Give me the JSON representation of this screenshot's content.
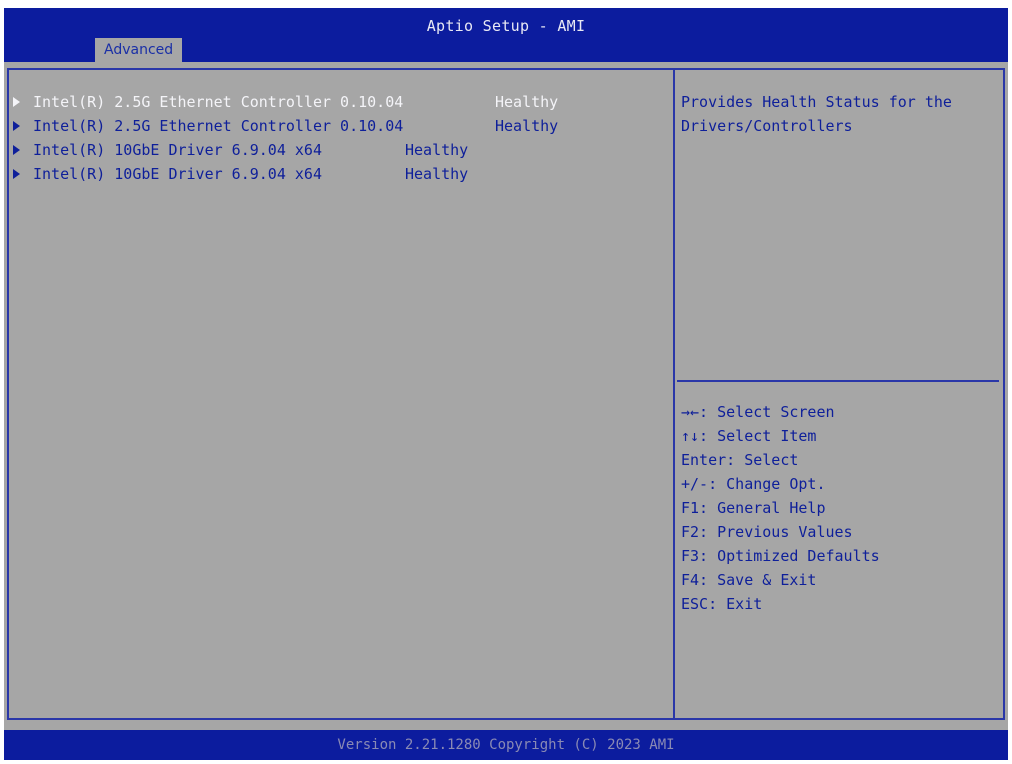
{
  "window": {
    "title": "Aptio Setup - AMI"
  },
  "tabs": [
    {
      "label": "Advanced",
      "active": true
    }
  ],
  "items": [
    {
      "label": "Intel(R) 2.5G Ethernet Controller 0.10.04",
      "status": "Healthy",
      "selected": true
    },
    {
      "label": "Intel(R) 2.5G Ethernet Controller 0.10.04",
      "status": "Healthy",
      "selected": false
    },
    {
      "label": "Intel(R) 10GbE Driver 6.9.04 x64",
      "status": "Healthy",
      "selected": false
    },
    {
      "label": "Intel(R) 10GbE Driver 6.9.04 x64",
      "status": "Healthy",
      "selected": false
    }
  ],
  "help": {
    "line1": "Provides Health Status for the",
    "line2": "Drivers/Controllers"
  },
  "keys": [
    "→←: Select Screen",
    "↑↓: Select Item",
    "Enter: Select",
    "+/-: Change Opt.",
    "F1: General Help",
    "F2: Previous Values",
    "F3: Optimized Defaults",
    "F4: Save & Exit",
    "ESC: Exit"
  ],
  "footer": {
    "text": "Version 2.21.1280 Copyright (C) 2023 AMI"
  },
  "colors": {
    "header_bg": "#0c1c9e",
    "panel_bg": "#a6a6a6",
    "text_blue": "#0e1f9a",
    "selected_text": "#f4f4f8",
    "border": "#2a37a8"
  }
}
